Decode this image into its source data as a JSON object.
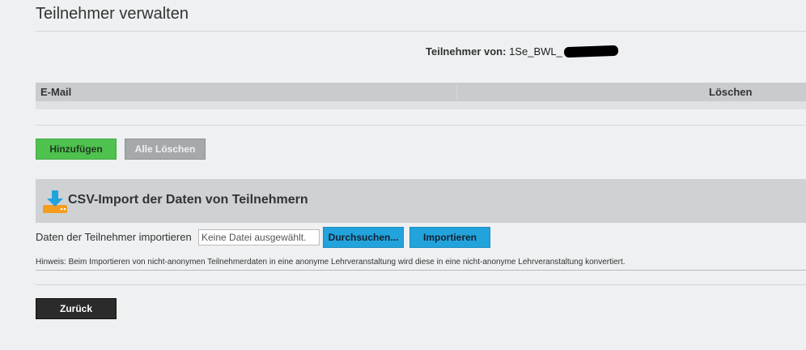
{
  "page": {
    "title": "Teilnehmer verwalten"
  },
  "owner": {
    "label": "Teilnehmer von:",
    "value": "1Se_BWL_"
  },
  "table": {
    "columns": [
      "E-Mail",
      "Löschen"
    ]
  },
  "buttons": {
    "add": "Hinzufügen",
    "delete_all": "Alle Löschen",
    "back": "Zurück"
  },
  "csv": {
    "title": "CSV-Import der Daten von Teilnehmern",
    "import_label": "Daten der Teilnehmer importieren",
    "file_status": "Keine Datei ausgewählt.",
    "browse": "Durchsuchen...",
    "import": "Importieren",
    "hint": "Hinweis: Beim Importieren von nicht-anonymen Teilnehmerdaten in eine anonyme Lehrveranstaltung wird diese in eine nicht-anonyme Lehrveranstaltung konvertiert."
  },
  "colors": {
    "add_button": "#4fc14f",
    "import_buttons": "#23a3dc",
    "back_button": "#2b2b2b",
    "icon_orange": "#f39c1f",
    "icon_blue": "#23a3dc"
  }
}
